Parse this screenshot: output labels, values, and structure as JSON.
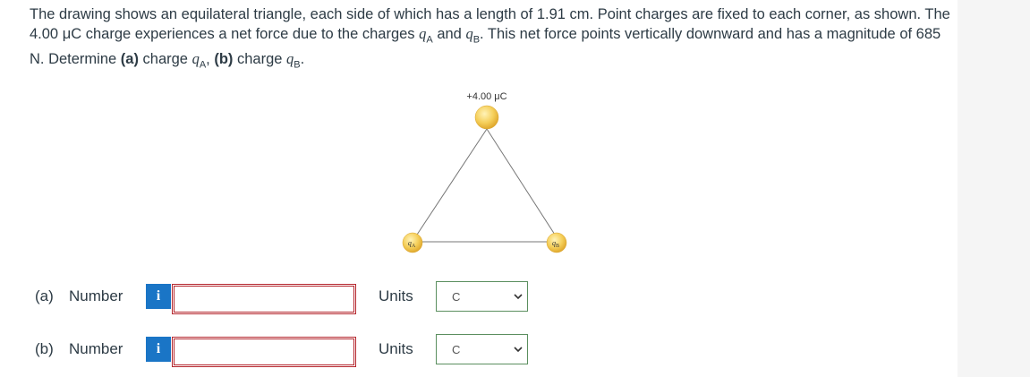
{
  "question": {
    "p1": "The drawing shows an equilateral triangle, each side of which has a length of 1.91 cm. Point charges are fixed to each corner, as shown. The 4.00 ",
    "mu": "μC",
    "p2": " charge experiences a net force due to the charges ",
    "q_letter": "q",
    "sub_a": "A",
    "and": " and ",
    "sub_b": "B",
    "p3": ". This net force points vertically downward and has a magnitude of 685 N. Determine ",
    "part_a": "(a)",
    "charge_a_text": " charge ",
    "comma": ", ",
    "part_b": "(b)",
    "charge_b_text": " charge ",
    "period": "."
  },
  "figure": {
    "top_charge_label": "+4.00 μC",
    "qa_label": "q",
    "qa_sub": "A",
    "qb_label": "q",
    "qb_sub": "B",
    "colors": {
      "charge_fill": "#f5cf5a",
      "charge_stroke": "#d9a42e",
      "line": "#777777"
    }
  },
  "answers": [
    {
      "part_label": "(a)",
      "number_label": "Number",
      "info_icon": "i",
      "value": "",
      "units_label": "Units",
      "unit_selected": "C"
    },
    {
      "part_label": "(b)",
      "number_label": "Number",
      "info_icon": "i",
      "value": "",
      "units_label": "Units",
      "unit_selected": "C"
    }
  ],
  "colors": {
    "info_button": "#1a75c6",
    "input_border": "#b5272e",
    "select_border": "#5b8f5f",
    "text": "#2d3b45"
  }
}
